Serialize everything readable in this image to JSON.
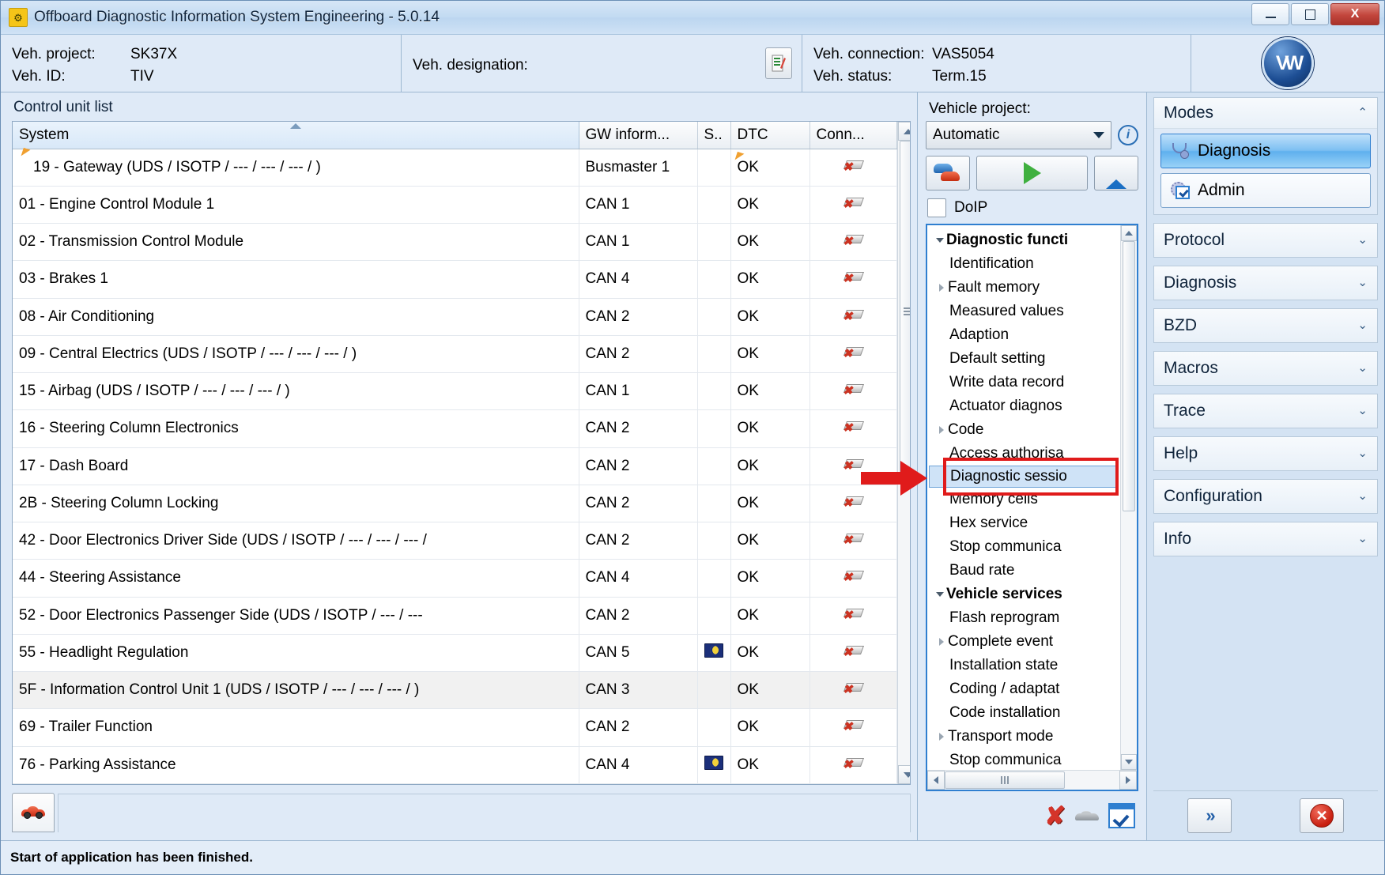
{
  "window": {
    "title": "Offboard Diagnostic Information System Engineering - 5.0.14",
    "app_icon": "engine-warning-icon",
    "minimize": "–",
    "maximize": "□",
    "close": "X"
  },
  "header": {
    "veh_project_label": "Veh. project:",
    "veh_project_value": "SK37X",
    "veh_id_label": "Veh. ID:",
    "veh_id_value": "TIV",
    "veh_designation_label": "Veh. designation:",
    "veh_designation_value": "",
    "veh_connection_label": "Veh. connection:",
    "veh_connection_value": "VAS5054",
    "veh_status_label": "Veh. status:",
    "veh_status_value": "Term.15",
    "logo": "VW"
  },
  "control_unit_list": {
    "title": "Control unit list",
    "columns": [
      "System",
      "GW inform...",
      "S..",
      "DTC",
      "Conn..."
    ],
    "sorted_column": "System",
    "rows": [
      {
        "system": "19 - Gateway  (UDS / ISOTP / --- / --- / --- /  )",
        "gw": "Busmaster 1",
        "s": "",
        "dtc": "OK",
        "conn": "disconnected-icon",
        "indent": 0,
        "selected": false,
        "cursor": true
      },
      {
        "system": "01 - Engine Control Module 1",
        "gw": "CAN 1",
        "s": "",
        "dtc": "OK",
        "conn": "disconnected-icon",
        "indent": 1,
        "selected": false,
        "cursor": false
      },
      {
        "system": "02 - Transmission Control Module",
        "gw": "CAN 1",
        "s": "",
        "dtc": "OK",
        "conn": "disconnected-icon",
        "indent": 1,
        "selected": false,
        "cursor": false
      },
      {
        "system": "03 - Brakes 1",
        "gw": "CAN 4",
        "s": "",
        "dtc": "OK",
        "conn": "disconnected-icon",
        "indent": 1,
        "selected": false,
        "cursor": false
      },
      {
        "system": "08 - Air Conditioning",
        "gw": "CAN 2",
        "s": "",
        "dtc": "OK",
        "conn": "disconnected-icon",
        "indent": 1,
        "selected": false,
        "cursor": false
      },
      {
        "system": "09 - Central Electrics  (UDS / ISOTP / --- / --- / --- /  )",
        "gw": "CAN 2",
        "s": "",
        "dtc": "OK",
        "conn": "disconnected-icon",
        "indent": 1,
        "selected": false,
        "cursor": false
      },
      {
        "system": "15 - Airbag  (UDS / ISOTP / --- / --- / --- /  )",
        "gw": "CAN 1",
        "s": "",
        "dtc": "OK",
        "conn": "disconnected-icon",
        "indent": 1,
        "selected": false,
        "cursor": false
      },
      {
        "system": "16 - Steering Column Electronics",
        "gw": "CAN 2",
        "s": "",
        "dtc": "OK",
        "conn": "disconnected-icon",
        "indent": 1,
        "selected": false,
        "cursor": false
      },
      {
        "system": "17 - Dash Board",
        "gw": "CAN 2",
        "s": "",
        "dtc": "OK",
        "conn": "disconnected-icon",
        "indent": 1,
        "selected": false,
        "cursor": false
      },
      {
        "system": "2B - Steering Column Locking",
        "gw": "CAN 2",
        "s": "",
        "dtc": "OK",
        "conn": "disconnected-icon",
        "indent": 1,
        "selected": false,
        "cursor": false
      },
      {
        "system": "42 - Door Electronics Driver Side  (UDS / ISOTP / --- / --- / --- /",
        "gw": "CAN 2",
        "s": "",
        "dtc": "OK",
        "conn": "disconnected-icon",
        "indent": 1,
        "selected": false,
        "cursor": false
      },
      {
        "system": "44 - Steering Assistance",
        "gw": "CAN 4",
        "s": "",
        "dtc": "OK",
        "conn": "disconnected-icon",
        "indent": 1,
        "selected": false,
        "cursor": false
      },
      {
        "system": "52 - Door Electronics Passenger Side  (UDS / ISOTP / --- / ---",
        "gw": "CAN 2",
        "s": "",
        "dtc": "OK",
        "conn": "disconnected-icon",
        "indent": 1,
        "selected": false,
        "cursor": false
      },
      {
        "system": "55 - Headlight Regulation",
        "gw": "CAN 5",
        "s": "sleep-mode-icon",
        "dtc": "OK",
        "conn": "disconnected-icon",
        "indent": 1,
        "selected": false,
        "cursor": false
      },
      {
        "system": "5F - Information Control Unit 1  (UDS / ISOTP / --- / --- / --- /  )",
        "gw": "CAN 3",
        "s": "",
        "dtc": "OK",
        "conn": "disconnected-icon",
        "indent": 1,
        "selected": true,
        "cursor": false
      },
      {
        "system": "69 - Trailer Function",
        "gw": "CAN 2",
        "s": "",
        "dtc": "OK",
        "conn": "disconnected-icon",
        "indent": 1,
        "selected": false,
        "cursor": false
      },
      {
        "system": "76 - Parking Assistance",
        "gw": "CAN 4",
        "s": "sleep-mode-icon",
        "dtc": "OK",
        "conn": "disconnected-icon",
        "indent": 1,
        "selected": false,
        "cursor": false
      }
    ]
  },
  "vehicle_project": {
    "label": "Vehicle project:",
    "selected": "Automatic",
    "info_icon": "info-icon",
    "buttons": [
      {
        "name": "vehicle-select-button",
        "icon": "two-cars-icon"
      },
      {
        "name": "start-button",
        "icon": "play-icon"
      },
      {
        "name": "eject-button",
        "icon": "eject-icon"
      }
    ],
    "doip_label": "DoIP",
    "doip_checked": false
  },
  "diagnostic_tree": {
    "nodes": [
      {
        "label": "Diagnostic functi",
        "type": "root",
        "expanded": true
      },
      {
        "label": "Identification",
        "type": "leaf"
      },
      {
        "label": "Fault memory",
        "type": "branch"
      },
      {
        "label": "Measured values",
        "type": "leaf"
      },
      {
        "label": "Adaption",
        "type": "leaf"
      },
      {
        "label": "Default setting",
        "type": "leaf"
      },
      {
        "label": "Write data record",
        "type": "leaf"
      },
      {
        "label": "Actuator diagnos",
        "type": "leaf"
      },
      {
        "label": "Code",
        "type": "branch"
      },
      {
        "label": "Access authorisa",
        "type": "leaf"
      },
      {
        "label": "Diagnostic sessio",
        "type": "leaf",
        "selected": true
      },
      {
        "label": "Memory cells",
        "type": "leaf"
      },
      {
        "label": "Hex service",
        "type": "leaf"
      },
      {
        "label": "Stop communica",
        "type": "leaf"
      },
      {
        "label": "Baud rate",
        "type": "leaf"
      },
      {
        "label": "Vehicle services",
        "type": "root",
        "expanded": true
      },
      {
        "label": "Flash reprogram",
        "type": "leaf"
      },
      {
        "label": "Complete event",
        "type": "branch"
      },
      {
        "label": "Installation state",
        "type": "leaf"
      },
      {
        "label": "Coding / adaptat",
        "type": "leaf"
      },
      {
        "label": "Code installation",
        "type": "leaf"
      },
      {
        "label": "Transport mode",
        "type": "branch"
      },
      {
        "label": "Stop communica",
        "type": "leaf"
      }
    ]
  },
  "mid_bottom_buttons": [
    {
      "name": "cancel-icon",
      "glyph": "✘"
    },
    {
      "name": "vehicle-grey-icon",
      "glyph": ""
    },
    {
      "name": "confirm-window-icon",
      "glyph": ""
    }
  ],
  "right_panel": {
    "modes": {
      "title": "Modes",
      "collapse_glyph": "⌃",
      "items": [
        {
          "label": "Diagnosis",
          "icon": "stethoscope-icon",
          "active": true
        },
        {
          "label": "Admin",
          "icon": "gear-check-icon",
          "active": false
        }
      ]
    },
    "sections": [
      {
        "label": "Protocol",
        "glyph": "⌄"
      },
      {
        "label": "Diagnosis",
        "glyph": "⌄"
      },
      {
        "label": "BZD",
        "glyph": "⌄"
      },
      {
        "label": "Macros",
        "glyph": "⌄"
      },
      {
        "label": "Trace",
        "glyph": "⌄"
      },
      {
        "label": "Help",
        "glyph": "⌄"
      },
      {
        "label": "Configuration",
        "glyph": "⌄"
      },
      {
        "label": "Info",
        "glyph": "⌄"
      }
    ],
    "bottom_buttons": [
      {
        "name": "next-button",
        "glyph": "»"
      },
      {
        "name": "stop-button",
        "glyph": "✕"
      }
    ]
  },
  "status_bar": {
    "message": "Start of application has been finished."
  },
  "annotation": {
    "type": "red-arrow-and-box",
    "target": "Diagnostic sessio"
  },
  "colors": {
    "accent": "#2f7fd0",
    "ok_green": "#0a7a22",
    "annotation_red": "#e01b1b",
    "window_blue": "#dfeaf7"
  }
}
